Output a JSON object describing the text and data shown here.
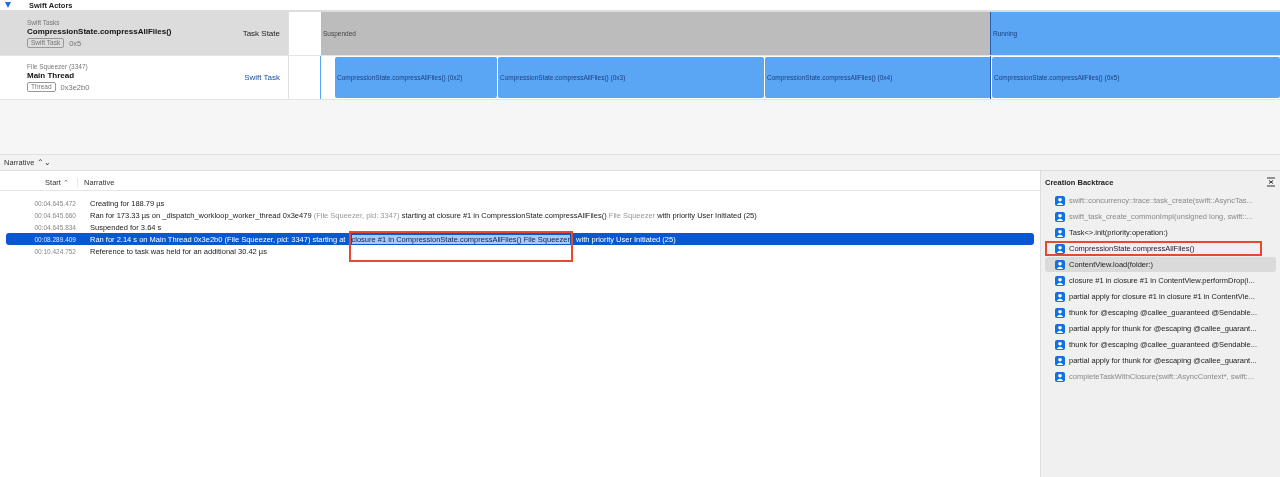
{
  "tracks": [
    {
      "kind": "group",
      "title": "Swift Actors",
      "expanded": true
    },
    {
      "kind": "task",
      "category": "Swift Tasks",
      "title": "CompressionState.compressAllFiles()",
      "tag": "Swift Task",
      "id": "0x5",
      "lane_label": "Task State",
      "segments": [
        {
          "kind": "suspended",
          "label": "Suspended"
        },
        {
          "kind": "running",
          "label": "Running"
        }
      ]
    },
    {
      "kind": "thread",
      "category": "File Squeezer (3347)",
      "title": "Main Thread",
      "tag": "Thread",
      "id": "0x3e2b0",
      "lane_label": "Swift Task",
      "segments": [
        {
          "kind": "run",
          "label": "CompressionState.compressAllFiles() (0x2)"
        },
        {
          "kind": "run",
          "label": "CompressionState.compressAllFiles() (0x3)"
        },
        {
          "kind": "run",
          "label": "CompressionState.compressAllFiles() (0x4)"
        },
        {
          "kind": "run",
          "label": "CompressionState.compressAllFiles() (0x5)"
        }
      ]
    }
  ],
  "detail_selector": "Narrative ⌃⌄",
  "table": {
    "columns": [
      {
        "label": "Start",
        "sort": "⌃"
      },
      {
        "label": "Narrative"
      }
    ],
    "rows": [
      {
        "start": "00:04.645.472",
        "selected": false,
        "parts": [
          {
            "text": "Creating for 188.79 µs",
            "dim": false
          }
        ]
      },
      {
        "start": "00:04.645.660",
        "selected": false,
        "parts": [
          {
            "text": "Ran for 173.33 µs on _dispatch_workloop_worker_thread  0x3e479",
            "dim": false
          },
          {
            "text": "(File Squeezer, pid: 3347)",
            "dim": true
          },
          {
            "text": "starting at closure #1 in CompressionState.compressAllFiles()",
            "dim": false
          },
          {
            "text": "File Squeezer",
            "dim": true
          },
          {
            "text": "with priority User Initiated (25)",
            "dim": false
          }
        ]
      },
      {
        "start": "00:04.645.834",
        "selected": false,
        "parts": [
          {
            "text": "Suspended for 3.64 s",
            "dim": false
          }
        ]
      },
      {
        "start": "00:08.289.409",
        "selected": true,
        "parts": [
          {
            "text": "Ran for 2.14 s on Main Thread  0x3e2b0 (File Squeezer, pid: 3347) starting at",
            "dim": false
          },
          {
            "text": "closure #1 in CompressionState.compressAllFiles()  File Squeezer",
            "dim": false,
            "highlighted": true,
            "annotated": true
          },
          {
            "text": "with priority User Initiated (25)",
            "dim": false
          }
        ]
      },
      {
        "start": "00:10.424.752",
        "selected": false,
        "parts": [
          {
            "text": "Reference to task was held for an additional 30.42 µs",
            "dim": false
          }
        ]
      }
    ]
  },
  "backtrace": {
    "title": "Creation Backtrace",
    "frames": [
      {
        "label": "swift::concurrency::trace::task_create(swift::AsyncTas...",
        "dim": true,
        "selected": false,
        "annotated": false
      },
      {
        "label": "swift_task_create_commonImpl(unsigned long, swift::...",
        "dim": true,
        "selected": false,
        "annotated": false
      },
      {
        "label": "Task<>.init(priority:operation:)",
        "dim": false,
        "selected": false,
        "annotated": false
      },
      {
        "label": "CompressionState.compressAllFiles()",
        "dim": false,
        "selected": false,
        "annotated": true
      },
      {
        "label": "ContentView.load(folder:)",
        "dim": false,
        "selected": true,
        "annotated": false
      },
      {
        "label": "closure #1 in closure #1 in ContentView.performDrop(i...",
        "dim": false,
        "selected": false,
        "annotated": false
      },
      {
        "label": "partial apply for closure #1 in closure #1 in ContentVie...",
        "dim": false,
        "selected": false,
        "annotated": false
      },
      {
        "label": "thunk for @escaping @callee_guaranteed @Sendable...",
        "dim": false,
        "selected": false,
        "annotated": false
      },
      {
        "label": "partial apply for thunk for @escaping @callee_guarant...",
        "dim": false,
        "selected": false,
        "annotated": false
      },
      {
        "label": "thunk for @escaping @callee_guaranteed @Sendable...",
        "dim": false,
        "selected": false,
        "annotated": false
      },
      {
        "label": "partial apply for thunk for @escaping @callee_guarant...",
        "dim": false,
        "selected": false,
        "annotated": false
      },
      {
        "label": "completeTaskWithClosure(swift::AsyncContext*, swift:...",
        "dim": true,
        "selected": false,
        "annotated": false
      }
    ]
  }
}
